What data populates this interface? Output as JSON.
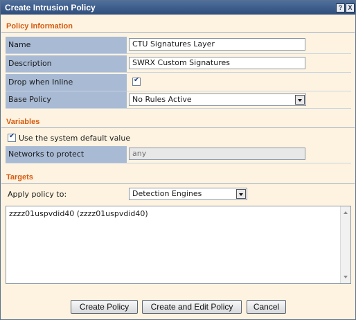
{
  "dialog": {
    "title": "Create Intrusion Policy",
    "help_label": "?",
    "close_label": "X"
  },
  "policy_info": {
    "header": "Policy Information",
    "name_label": "Name",
    "name_value": "CTU Signatures Layer",
    "description_label": "Description",
    "description_value": "SWRX Custom Signatures",
    "drop_label": "Drop when Inline",
    "drop_checked": true,
    "base_policy_label": "Base Policy",
    "base_policy_value": "No Rules Active"
  },
  "variables": {
    "header": "Variables",
    "default_label": "Use the system default value",
    "default_checked": true,
    "networks_label": "Networks to protect",
    "networks_value": "any"
  },
  "targets": {
    "header": "Targets",
    "apply_label": "Apply policy to:",
    "apply_value": "Detection Engines",
    "list_items": [
      "zzzz01uspvdid40 (zzzz01uspvdid40)"
    ]
  },
  "buttons": {
    "create": "Create Policy",
    "create_edit": "Create and Edit Policy",
    "cancel": "Cancel"
  }
}
